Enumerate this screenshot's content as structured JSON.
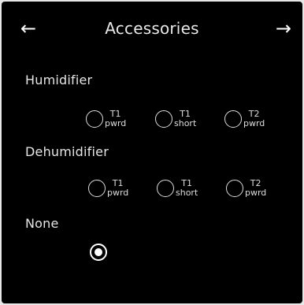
{
  "header": {
    "title": "Accessories",
    "back_icon": "←",
    "forward_icon": "→"
  },
  "sections": [
    {
      "label": "Humidifier",
      "options": [
        {
          "line1": "T1",
          "line2": "pwrd",
          "selected": false
        },
        {
          "line1": "T1",
          "line2": "short",
          "selected": false
        },
        {
          "line1": "T2",
          "line2": "pwrd",
          "selected": false
        }
      ]
    },
    {
      "label": "Dehumidifier",
      "options": [
        {
          "line1": "T1",
          "line2": "pwrd",
          "selected": false
        },
        {
          "line1": "T1",
          "line2": "short",
          "selected": false
        },
        {
          "line1": "T2",
          "line2": "pwrd",
          "selected": false
        }
      ]
    },
    {
      "label": "None",
      "selected": true
    }
  ]
}
